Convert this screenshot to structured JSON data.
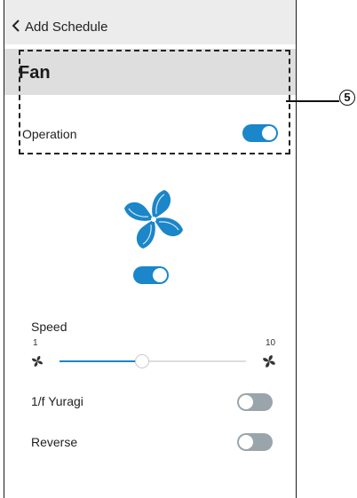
{
  "topbar": {
    "back_icon": "chevron-left-icon",
    "title": "Add Schedule"
  },
  "fan_section": {
    "title": "Fan",
    "operation_label": "Operation",
    "operation_on": true
  },
  "callout": {
    "number": "5"
  },
  "fan_icon": "fan-icon",
  "power_on": true,
  "speed": {
    "label": "Speed",
    "min_label": "1",
    "max_label": "10",
    "min": 1,
    "max": 10,
    "value": 5
  },
  "yuragi": {
    "label": "1/f Yuragi",
    "on": false
  },
  "reverse": {
    "label": "Reverse",
    "on": false
  },
  "colors": {
    "accent": "#1b86c9",
    "toggle_off": "#9aa5ab",
    "header_bg": "#ececec",
    "fan_header_bg": "#dedede"
  }
}
